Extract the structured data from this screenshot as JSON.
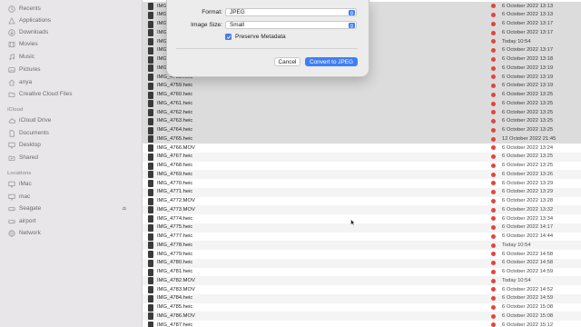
{
  "sidebar": {
    "favorites": [
      {
        "label": "Recents",
        "icon": "clock-icon"
      },
      {
        "label": "Applications",
        "icon": "applications-icon"
      },
      {
        "label": "Downloads",
        "icon": "download-icon"
      },
      {
        "label": "Movies",
        "icon": "film-icon"
      },
      {
        "label": "Music",
        "icon": "music-icon"
      },
      {
        "label": "Pictures",
        "icon": "photo-icon"
      },
      {
        "label": "anya",
        "icon": "home-icon"
      },
      {
        "label": "Creative Cloud Files",
        "icon": "cloud-files-icon"
      }
    ],
    "icloud_header": "iCloud",
    "icloud": [
      {
        "label": "iCloud Drive",
        "icon": "icloud-icon"
      },
      {
        "label": "Documents",
        "icon": "document-icon"
      },
      {
        "label": "Desktop",
        "icon": "desktop-icon"
      },
      {
        "label": "Shared",
        "icon": "shared-folder-icon"
      }
    ],
    "locations_header": "Locations",
    "locations": [
      {
        "label": "iMac",
        "icon": "computer-icon"
      },
      {
        "label": "mac",
        "icon": "computer-icon"
      },
      {
        "label": "Seagate",
        "icon": "drive-icon"
      },
      {
        "label": "airport",
        "icon": "drive-icon"
      },
      {
        "label": "Network",
        "icon": "network-icon"
      }
    ]
  },
  "dialog": {
    "format_label": "Format:",
    "format_value": "JPEG",
    "size_label": "Image Size:",
    "size_value": "Small",
    "preserve_label": "Preserve Metadata",
    "preserve_checked": true,
    "cancel_label": "Cancel",
    "convert_label": "Convert to JPEG",
    "accent_color": "#3f7ef6"
  },
  "files": [
    {
      "name": "IMG_475",
      "date": "6 October 2022 13:13",
      "selected": true
    },
    {
      "name": "IMG_475",
      "date": "6 October 2022 13:13",
      "selected": true
    },
    {
      "name": "IMG_475",
      "date": "6 October 2022 13:17",
      "selected": true
    },
    {
      "name": "IMG_475",
      "date": "6 October 2022 13:17",
      "selected": true
    },
    {
      "name": "IMG_475",
      "date": "Today 10:54",
      "selected": true
    },
    {
      "name": "IMG_475",
      "date": "6 October 2022 13:17",
      "selected": true
    },
    {
      "name": "IMG_475",
      "date": "6 October 2022 13:18",
      "selected": true
    },
    {
      "name": "IMG_475",
      "date": "6 October 2022 13:19",
      "selected": true
    },
    {
      "name": "IMG_4758.heic",
      "date": "6 October 2022 13:19",
      "selected": true
    },
    {
      "name": "IMG_4759.heic",
      "date": "6 October 2022 13:19",
      "selected": true
    },
    {
      "name": "IMG_4760.heic",
      "date": "6 October 2022 13:25",
      "selected": true
    },
    {
      "name": "IMG_4761.heic",
      "date": "6 October 2022 13:25",
      "selected": true
    },
    {
      "name": "IMG_4762.heic",
      "date": "6 October 2022 13:25",
      "selected": true
    },
    {
      "name": "IMG_4763.heic",
      "date": "6 October 2022 13:25",
      "selected": true
    },
    {
      "name": "IMG_4764.heic",
      "date": "6 October 2022 13:25",
      "selected": true
    },
    {
      "name": "IMG_4765.heic",
      "date": "12 October 2022 21:45",
      "selected": true
    },
    {
      "name": "IMG_4766.MOV",
      "date": "6 October 2022 13:24",
      "selected": false
    },
    {
      "name": "IMG_4767.heic",
      "date": "6 October 2022 13:25",
      "selected": false
    },
    {
      "name": "IMG_4768.heic",
      "date": "6 October 2022 13:25",
      "selected": false
    },
    {
      "name": "IMG_4769.heic",
      "date": "6 October 2022 13:26",
      "selected": false
    },
    {
      "name": "IMG_4770.heic",
      "date": "6 October 2022 13:29",
      "selected": false
    },
    {
      "name": "IMG_4771.heic",
      "date": "6 October 2022 13:29",
      "selected": false
    },
    {
      "name": "IMG_4772.MOV",
      "date": "6 October 2022 13:28",
      "selected": false
    },
    {
      "name": "IMG_4773.MOV",
      "date": "6 October 2022 13:32",
      "selected": false
    },
    {
      "name": "IMG_4774.heic",
      "date": "6 October 2022 13:34",
      "selected": false
    },
    {
      "name": "IMG_4775.heic",
      "date": "6 October 2022 14:17",
      "selected": false
    },
    {
      "name": "IMG_4777.heic",
      "date": "6 October 2022 14:44",
      "selected": false
    },
    {
      "name": "IMG_4778.heic",
      "date": "Today 10:54",
      "selected": false
    },
    {
      "name": "IMG_4779.heic",
      "date": "6 October 2022 14:58",
      "selected": false
    },
    {
      "name": "IMG_4780.heic",
      "date": "6 October 2022 14:58",
      "selected": false
    },
    {
      "name": "IMG_4781.heic",
      "date": "6 October 2022 14:59",
      "selected": false
    },
    {
      "name": "IMG_4782.MOV",
      "date": "Today 10:54",
      "selected": false
    },
    {
      "name": "IMG_4783.MOV",
      "date": "6 October 2022 14:52",
      "selected": false
    },
    {
      "name": "IMG_4784.heic",
      "date": "6 October 2022 14:59",
      "selected": false
    },
    {
      "name": "IMG_4785.heic",
      "date": "6 October 2022 15:08",
      "selected": false
    },
    {
      "name": "IMG_4786.MOV",
      "date": "6 October 2022 15:08",
      "selected": false
    },
    {
      "name": "IMG_4787.heic",
      "date": "6 October 2022 15:12",
      "selected": false
    }
  ],
  "tag_color": "#e2453c"
}
